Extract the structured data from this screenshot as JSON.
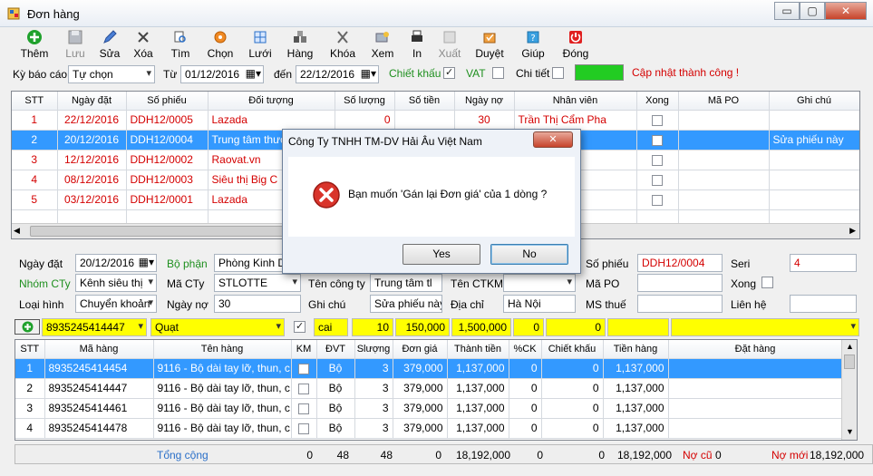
{
  "window": {
    "title": "Đơn hàng",
    "minimize": "▭",
    "maximize": "▢",
    "close": "✕"
  },
  "toolbar": [
    {
      "label": "Thêm",
      "icon": "add-icon",
      "disabled": false
    },
    {
      "label": "Lưu",
      "icon": "save-icon",
      "disabled": true
    },
    {
      "label": "Sửa",
      "icon": "edit-icon",
      "disabled": false
    },
    {
      "label": "Xóa",
      "icon": "delete-icon",
      "disabled": false
    },
    {
      "label": "Tìm",
      "icon": "search-icon",
      "disabled": false
    },
    {
      "label": "Chọn",
      "icon": "gear-icon",
      "disabled": false
    },
    {
      "label": "Lưới",
      "icon": "grid-icon",
      "disabled": false
    },
    {
      "label": "Hàng",
      "icon": "boxes-icon",
      "disabled": false
    },
    {
      "label": "Khóa",
      "icon": "lock-icon",
      "disabled": false
    },
    {
      "label": "Xem",
      "icon": "preview-icon",
      "disabled": false
    },
    {
      "label": "In",
      "icon": "print-icon",
      "disabled": false
    },
    {
      "label": "Xuất",
      "icon": "export-icon",
      "disabled": true
    },
    {
      "label": "Duyệt",
      "icon": "approve-icon",
      "disabled": false
    },
    {
      "label": "Giúp",
      "icon": "help-icon",
      "disabled": false
    },
    {
      "label": "Đóng",
      "icon": "power-icon",
      "disabled": false
    }
  ],
  "filter": {
    "period_label": "Kỳ báo cáo",
    "period_value": "Tự chọn",
    "from_label": "Từ",
    "from_value": "01/12/2016",
    "to_label": "đến",
    "to_value": "22/12/2016",
    "discount_label": "Chiết khấu",
    "discount_checked": true,
    "vat_label": "VAT",
    "vat_checked": false,
    "detail_label": "Chi tiết",
    "detail_checked": false,
    "status_message": "Cập nhật thành công !",
    "progress": 1.0
  },
  "orders": {
    "columns": [
      "STT",
      "Ngày đặt",
      "Số phiếu",
      "Đối tượng",
      "Số lượng",
      "Số tiền",
      "Ngày nợ",
      "Nhân viên",
      "Xong",
      "Mã PO",
      "Ghi chú"
    ],
    "rows": [
      {
        "stt": "1",
        "date": "22/12/2016",
        "code": "DDH12/0005",
        "party": "Lazada",
        "qty": "0",
        "amount": "",
        "debt_days": "30",
        "staff": "Trần Thị Cẩm Pha",
        "note": "",
        "selected": false
      },
      {
        "stt": "2",
        "date": "20/12/2016",
        "code": "DDH12/0004",
        "party": "Trung tâm thươ",
        "qty": "",
        "amount": "",
        "debt_days": "",
        "staff": "",
        "note": "Sửa phiếu này",
        "selected": true
      },
      {
        "stt": "3",
        "date": "12/12/2016",
        "code": "DDH12/0002",
        "party": "Raovat.vn",
        "qty": "",
        "amount": "",
        "debt_days": "",
        "staff": "",
        "note": "",
        "selected": false
      },
      {
        "stt": "4",
        "date": "08/12/2016",
        "code": "DDH12/0003",
        "party": "Siêu thị Big C",
        "qty": "",
        "amount": "",
        "debt_days": "",
        "staff": "",
        "note": "",
        "selected": false
      },
      {
        "stt": "5",
        "date": "03/12/2016",
        "code": "DDH12/0001",
        "party": "Lazada",
        "qty": "",
        "amount": "",
        "debt_days": "",
        "staff": "",
        "note": "",
        "selected": false
      }
    ]
  },
  "form": {
    "date_label": "Ngày đặt",
    "date_value": "20/12/2016",
    "dept_label": "Bộ phận",
    "dept_value": "Phòng Kinh Do",
    "voucher_label": "Số phiếu",
    "voucher_value": "DDH12/0004",
    "serial_label": "Seri",
    "serial_value": "4",
    "group_label": "Nhóm CTy",
    "group_value": "Kênh siêu thị",
    "company_code_label": "Mã CTy",
    "company_code_value": "STLOTTE",
    "company_name_label": "Tên công ty",
    "company_name_value": "Trung tâm tl",
    "city_label": "Tên CTKM",
    "po_label": "Mã PO",
    "po_value": "",
    "done_label": "Xong",
    "type_label": "Loại hình",
    "type_value": "Chuyển khoản",
    "debt_label": "Ngày nợ",
    "debt_value": "30",
    "note_label": "Ghi chú",
    "note_value": "Sửa phiếu này",
    "address_label": "Địa chỉ",
    "address_value": "Hà Nội",
    "tax_label": "MS thuế",
    "tax_value": "",
    "contact_label": "Liên hệ",
    "contact_value": ""
  },
  "entry": {
    "barcode": "8935245414447",
    "product": "Quạt",
    "unit": "cai",
    "qty": "10",
    "price": "150,000",
    "total": "1,500,000",
    "ck": "0",
    "discount": "0"
  },
  "items": {
    "columns": [
      "STT",
      "Mã hàng",
      "Tên hàng",
      "KM",
      "ĐVT",
      "Slượng",
      "Đơn giá",
      "Thành tiền",
      "%CK",
      "Chiết khấu",
      "Tiền hàng",
      "Đặt hàng"
    ],
    "rows": [
      {
        "stt": "1",
        "code": "8935245414454",
        "name": "9116 - Bộ dài tay lỡ, thun, c...",
        "unit": "Bộ",
        "qty": "3",
        "price": "379,000",
        "total": "1,137,000",
        "ck": "0",
        "discount": "0",
        "amount": "1,137,000",
        "selected": true
      },
      {
        "stt": "2",
        "code": "8935245414447",
        "name": "9116 - Bộ dài tay lỡ, thun, c...",
        "unit": "Bộ",
        "qty": "3",
        "price": "379,000",
        "total": "1,137,000",
        "ck": "0",
        "discount": "0",
        "amount": "1,137,000",
        "selected": false
      },
      {
        "stt": "3",
        "code": "8935245414461",
        "name": "9116 - Bộ dài tay lỡ, thun, c...",
        "unit": "Bộ",
        "qty": "3",
        "price": "379,000",
        "total": "1,137,000",
        "ck": "0",
        "discount": "0",
        "amount": "1,137,000",
        "selected": false
      },
      {
        "stt": "4",
        "code": "8935245414478",
        "name": "9116 - Bộ dài tay lỡ, thun, c...",
        "unit": "Bộ",
        "qty": "3",
        "price": "379,000",
        "total": "1,137,000",
        "ck": "0",
        "discount": "0",
        "amount": "1,137,000",
        "selected": false
      }
    ]
  },
  "totals": {
    "label": "Tổng cộng",
    "km": "0",
    "unit": "48",
    "qty": "48",
    "price": "0",
    "total": "18,192,000",
    "ck": "0",
    "discount": "0",
    "amount": "18,192,000",
    "old_debt_label": "Nợ cũ",
    "old_debt": "0",
    "new_debt_label": "Nợ mới",
    "new_debt": "18,192,000"
  },
  "dialog": {
    "title": "Công Ty TNHH TM-DV Hải Âu Việt Nam",
    "close": "✕",
    "message": "Bạn muốn 'Gán lại Đơn giá' của 1 dòng ?",
    "yes": "Yes",
    "no": "No"
  },
  "colors": {
    "selection": "#3399ff",
    "red_text": "#d40000",
    "green_label": "#1e8f1e",
    "yellow_entry": "#ffff00",
    "progress_green": "#22cc22"
  }
}
